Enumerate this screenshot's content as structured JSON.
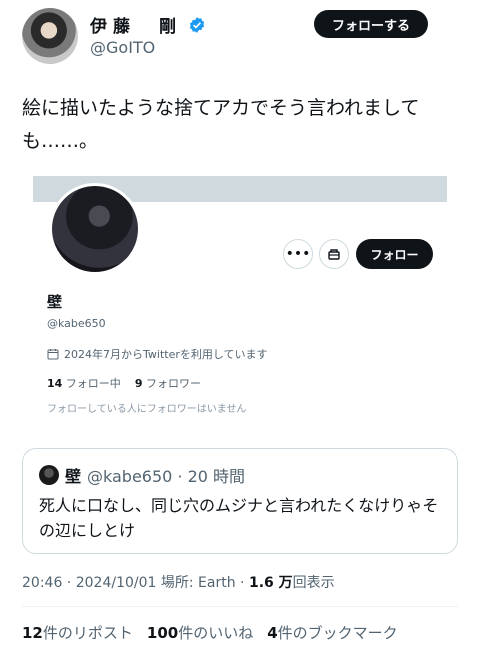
{
  "author": {
    "name": "伊藤　剛",
    "handle": "@GoITO",
    "follow_label": "フォローする",
    "verified_color": "#1d9bf0"
  },
  "tweet": {
    "text": "絵に描いたような捨てアカでそう言われましても……。"
  },
  "embedded_profile": {
    "name": "壁",
    "handle": "@kabe650",
    "joined": "2024年7月からTwitterを利用しています",
    "following_count": "14",
    "following_label": "フォロー中",
    "followers_count": "9",
    "followers_label": "フォロワー",
    "note": "フォローしている人にフォロワーはいません",
    "follow_label": "フォロー",
    "more_icon": "more-icon",
    "share_icon": "share-icon"
  },
  "quote": {
    "name": "壁",
    "meta": "@kabe650 · 20 時間",
    "text": "死人に口なし、同じ穴のムジナと言われたくなけりゃその辺にしとけ"
  },
  "meta": {
    "time": "20:46",
    "date": "2024/10/01",
    "location_label": "場所: Earth",
    "views_count": "1.6 万",
    "views_label": "回表示"
  },
  "stats": {
    "reposts_count": "12",
    "reposts_label": "件のリポスト",
    "likes_count": "100",
    "likes_label": "件のいいね",
    "bookmarks_count": "4",
    "bookmarks_label": "件のブックマーク"
  }
}
